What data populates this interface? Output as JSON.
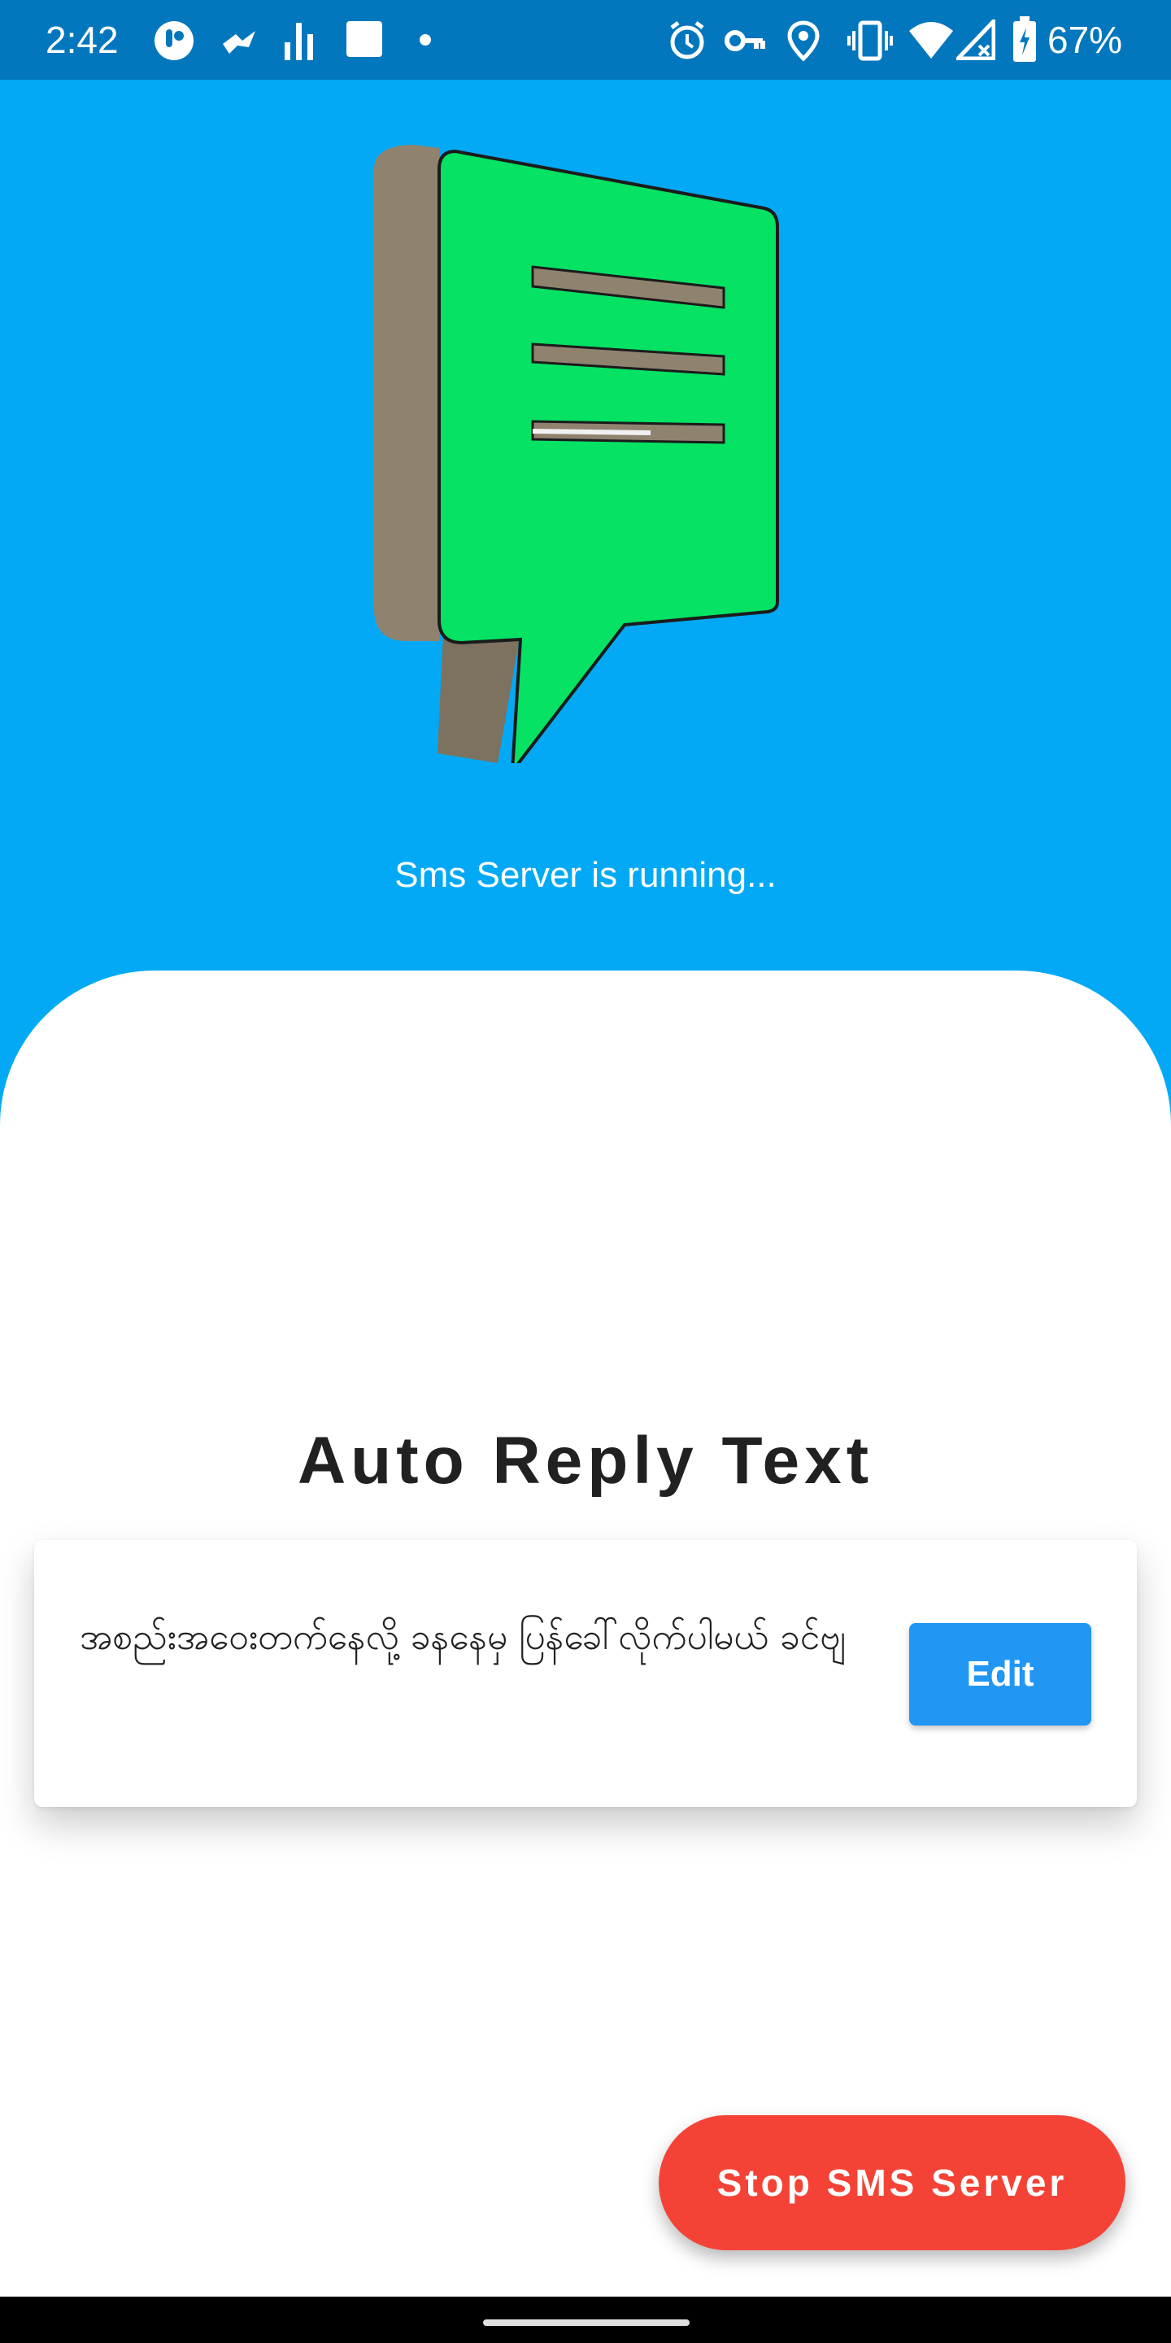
{
  "status_bar": {
    "time": "2:42",
    "battery_percent": "67%",
    "background_color": "#0277bd",
    "left_icons": [
      "app-notification-icon",
      "bird-notification-icon",
      "chart-notification-icon",
      "square-notification-icon",
      "dot-notification-icon"
    ],
    "right_icons": [
      "alarm-icon",
      "vpn-key-icon",
      "location-icon",
      "vibrate-icon",
      "wifi-icon",
      "cell-signal-icon",
      "battery-charging-icon"
    ]
  },
  "hero": {
    "background_color": "#03a9f4",
    "logo_icon": "sms-message-bubble-icon",
    "status_text": "Sms Server is running..."
  },
  "auto_reply": {
    "title": "Auto Reply Text",
    "message": "အစည်းအဝေးတက်နေလို့ ခနနေမှ ပြန်ခေါ်လိုက်ပါမယ် ခင်ဗျ",
    "edit_label": "Edit",
    "edit_color": "#2196f3"
  },
  "stop_button": {
    "label": "Stop SMS Server",
    "color": "#f44336"
  }
}
